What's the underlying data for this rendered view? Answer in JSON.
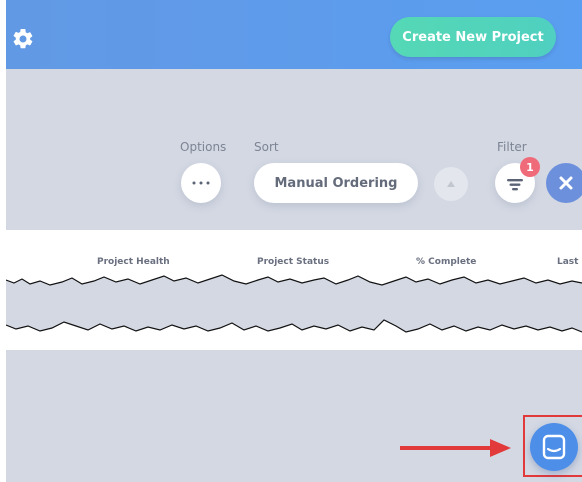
{
  "header": {
    "create_button_label": "Create New Project"
  },
  "toolbar": {
    "options_label": "Options",
    "sort_label": "Sort",
    "sort_value": "Manual Ordering",
    "filter_label": "Filter",
    "filter_count": "1"
  },
  "table": {
    "columns": [
      "Project Health",
      "Project Status",
      "% Complete",
      "Last"
    ]
  },
  "colors": {
    "header_blue": "#5a9ef1",
    "create_button": "#55d8b5",
    "badge": "#ef6b79",
    "chat_button": "#4d8ee9",
    "annotation_red": "#e23a3a"
  },
  "icons": [
    "gear-icon",
    "more-dots-icon",
    "sort-arrow-up-icon",
    "filter-icon",
    "close-icon",
    "chat-icon"
  ]
}
